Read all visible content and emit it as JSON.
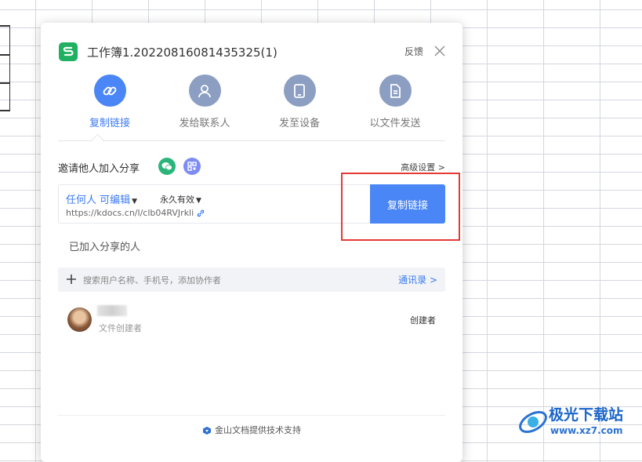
{
  "dialog": {
    "title": "工作簿1.20220816081435325(1)",
    "feedback_label": "反馈"
  },
  "tabs": [
    {
      "label": "复制链接",
      "icon": "link-icon",
      "active": true
    },
    {
      "label": "发给联系人",
      "icon": "person-icon",
      "active": false
    },
    {
      "label": "发至设备",
      "icon": "tablet-icon",
      "active": false
    },
    {
      "label": "以文件发送",
      "icon": "document-icon",
      "active": false
    }
  ],
  "invite": {
    "label": "邀请他人加入分享",
    "advanced_label": "高级设置 >"
  },
  "link": {
    "permission": "任何人 可编辑",
    "expiry": "永久有效",
    "url": "https://kdocs.cn/l/clb04RVJrkli",
    "copy_button": "复制链接"
  },
  "members": {
    "section_label": "已加入分享的人",
    "search_placeholder": "搜索用户名称、手机号，添加协作者",
    "contacts_label": "通讯录 >",
    "list": [
      {
        "subtitle": "文件创建者",
        "role": "创建者"
      }
    ]
  },
  "footer": {
    "text": "金山文档提供技术支持"
  },
  "watermark": {
    "text": "极光下载站",
    "url": "www.xz7.com"
  },
  "colors": {
    "accent": "#4a86f5",
    "app_green": "#1fb161",
    "highlight_red": "#e53935"
  }
}
